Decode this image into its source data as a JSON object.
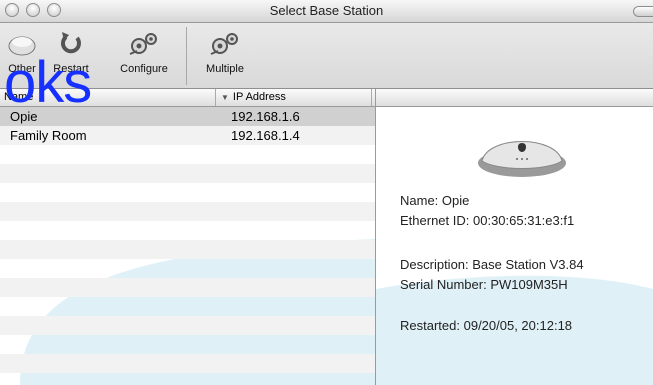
{
  "window": {
    "title": "Select Base Station"
  },
  "toolbar": {
    "items": [
      {
        "label": "Other",
        "icon": "base-station-icon"
      },
      {
        "label": "Restart",
        "icon": "restart-arrow-icon"
      },
      {
        "label": "Configure",
        "icon": "configure-gears-icon"
      },
      {
        "label": "Multiple",
        "icon": "multiple-gears-icon"
      }
    ]
  },
  "overlay": {
    "text": "oks"
  },
  "list": {
    "columns": {
      "name": "Name",
      "ip": "IP Address"
    },
    "sorted_by": "ip",
    "rows": [
      {
        "name": "Opie",
        "ip": "192.168.1.6",
        "selected": true
      },
      {
        "name": "Family Room",
        "ip": "192.168.1.4",
        "selected": false
      }
    ]
  },
  "details": {
    "name_label": "Name:",
    "name": "Opie",
    "ethernet_label": "Ethernet ID:",
    "ethernet_id": "00:30:65:31:e3:f1",
    "description_label": "Description:",
    "description": "Base Station V3.84",
    "serial_label": "Serial Number:",
    "serial": "PW109M35H",
    "restarted_label": "Restarted:",
    "restarted": "09/20/05, 20:12:18"
  },
  "colors": {
    "overlay": "#1530ff",
    "wave": "#dff0f7",
    "selection": "#d0d0d0"
  }
}
